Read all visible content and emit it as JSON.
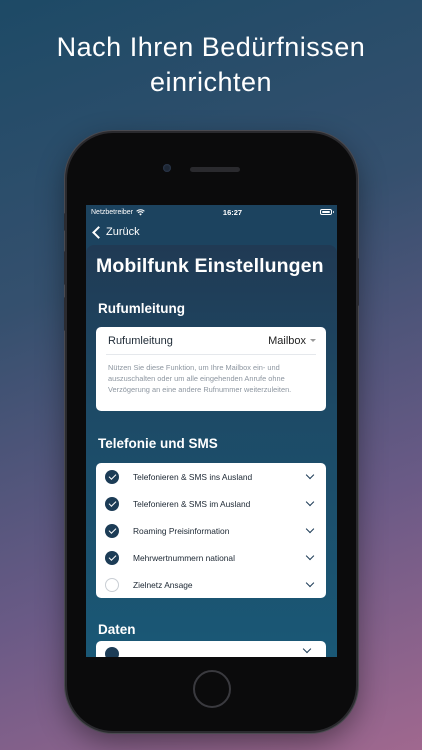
{
  "headline": {
    "line1": "Nach Ihren Bedürfnissen",
    "line2": "einrichten"
  },
  "status_bar": {
    "carrier": "Netzbetreiber",
    "time": "16:27"
  },
  "nav": {
    "back_label": "Zurück"
  },
  "page": {
    "title": "Mobilfunk Einstellungen"
  },
  "forwarding": {
    "section_title": "Rufumleitung",
    "row_label": "Rufumleitung",
    "selected_value": "Mailbox",
    "description": "Nützen Sie diese Funktion, um Ihre Mailbox ein- und auszuschalten oder um alle eingehenden Anrufe ohne Verzögerung an eine andere Rufnummer weiterzuleiten."
  },
  "telephony": {
    "section_title": "Telefonie und SMS",
    "items": [
      {
        "label": "Telefonieren & SMS ins Ausland",
        "checked": true
      },
      {
        "label": "Telefonieren & SMS im Ausland",
        "checked": true
      },
      {
        "label": "Roaming Preisinformation",
        "checked": true
      },
      {
        "label": "Mehrwertnummern national",
        "checked": true
      },
      {
        "label": "Zielnetz Ansage",
        "checked": false
      }
    ]
  },
  "data_section": {
    "section_title": "Daten"
  },
  "colors": {
    "check_on": "#1c3c56",
    "accent_text": "#ffffff"
  }
}
